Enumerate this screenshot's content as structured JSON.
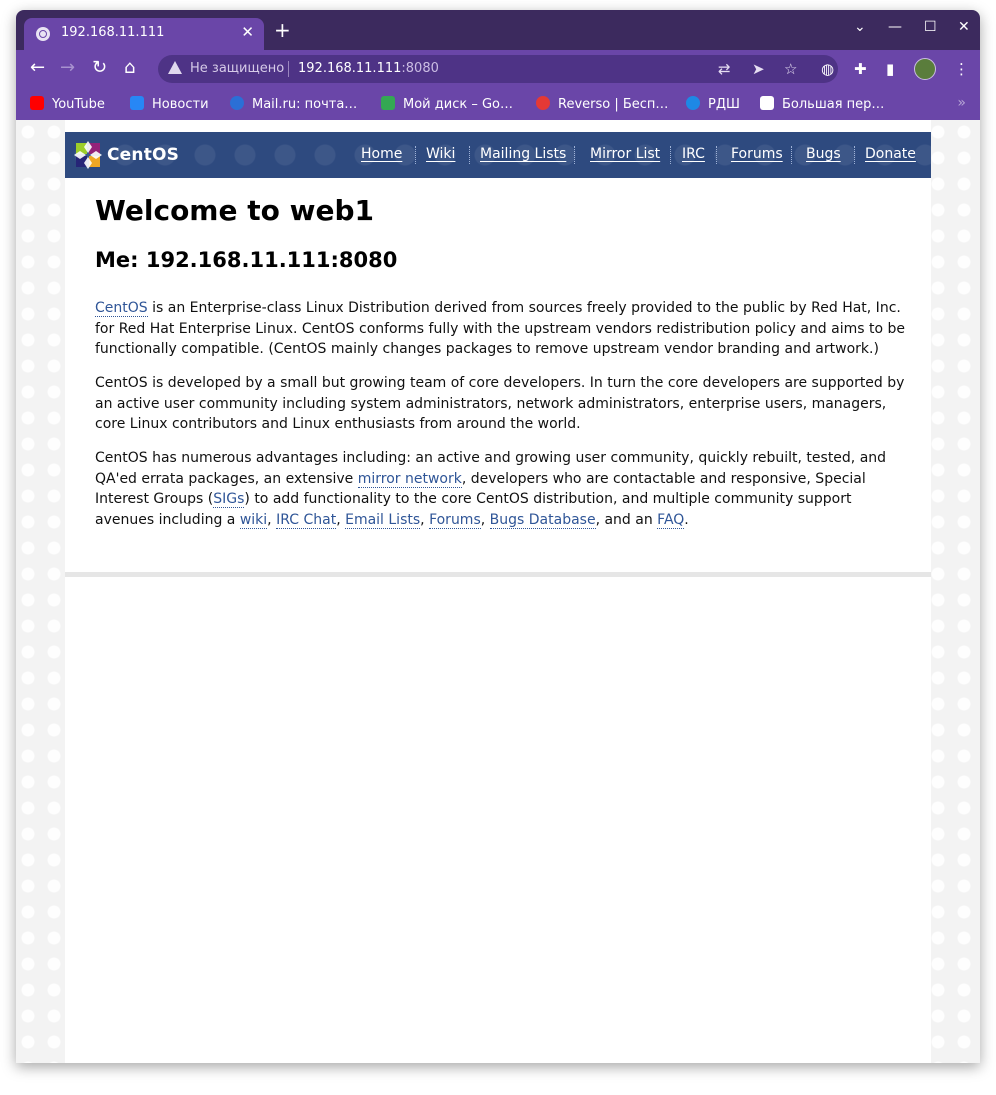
{
  "browser": {
    "tab_title": "192.168.11.111",
    "tab_close": "✕",
    "new_tab": "+",
    "window_controls": {
      "chevron": "⌄",
      "minimize": "—",
      "maximize": "☐",
      "close": "✕"
    },
    "nav": {
      "back": "←",
      "forward": "→",
      "reload": "↻",
      "home": "⌂"
    },
    "address": {
      "security_label": "Не защищено",
      "host": "192.168.11.111",
      "port": ":8080"
    },
    "toolbar_icons": [
      "translate-icon",
      "send-icon",
      "star-icon",
      "globe-icon",
      "puzzle-icon",
      "sidepanel-icon",
      "profile-avatar",
      "kebab-menu-icon"
    ],
    "bookmarks": [
      {
        "label": "YouTube",
        "icon": "youtube-icon",
        "color": "#ff0000"
      },
      {
        "label": "Новости",
        "icon": "vk-icon",
        "color": "#2787f5"
      },
      {
        "label": "Mail.ru: почта…",
        "icon": "mailru-icon",
        "color": "#2b6fd6"
      },
      {
        "label": "Мой диск – Go…",
        "icon": "google-drive-icon",
        "color": "#34a853"
      },
      {
        "label": "Reverso | Бесп…",
        "icon": "reverso-icon",
        "color": "#e53935"
      },
      {
        "label": "РДШ",
        "icon": "rdsh-icon",
        "color": "#1e88e5"
      },
      {
        "label": "Большая пер…",
        "icon": "page-icon",
        "color": "#ffffff"
      }
    ],
    "bookmarks_more": "»",
    "colors": {
      "tabstrip": "#3c2a5e",
      "toolbar": "#6a46a8"
    }
  },
  "site": {
    "logo_text": "CentOS",
    "menu": [
      "Home",
      "Wiki",
      "Mailing Lists",
      "Mirror List",
      "IRC",
      "Forums",
      "Bugs",
      "Donate"
    ],
    "heading": "Welcome to web1",
    "subheading": "Me: 192.168.11.111:8080",
    "p1": {
      "link": "CentOS",
      "text": " is an Enterprise-class Linux Distribution derived from sources freely provided to the public by Red Hat, Inc. for Red Hat Enterprise Linux. CentOS conforms fully with the upstream vendors redistribution policy and aims to be functionally compatible. (CentOS mainly changes packages to remove upstream vendor branding and artwork.)"
    },
    "p2": "CentOS is developed by a small but growing team of core developers.  In turn the core developers are supported by an active user community including system administrators, network administrators, enterprise users, managers, core Linux contributors and Linux enthusiasts from around the world.",
    "p3": {
      "t1": "CentOS has numerous advantages including: an active and growing user community, quickly rebuilt, tested, and QA'ed errata packages, an extensive ",
      "l1": "mirror network",
      "t2": ", developers who are contactable and responsive, Special Interest Groups (",
      "l2": "SIGs",
      "t3": ") to add functionality to the core CentOS distribution, and multiple community support avenues including a ",
      "l3": "wiki",
      "t4": ", ",
      "l4": "IRC Chat",
      "t5": ", ",
      "l5": "Email Lists",
      "t6": ", ",
      "l6": "Forums",
      "t7": ", ",
      "l7": "Bugs Database",
      "t8": ", and an ",
      "l8": "FAQ",
      "t9": "."
    },
    "colors": {
      "header": "#2e4a7f",
      "link": "#2f5597"
    }
  }
}
